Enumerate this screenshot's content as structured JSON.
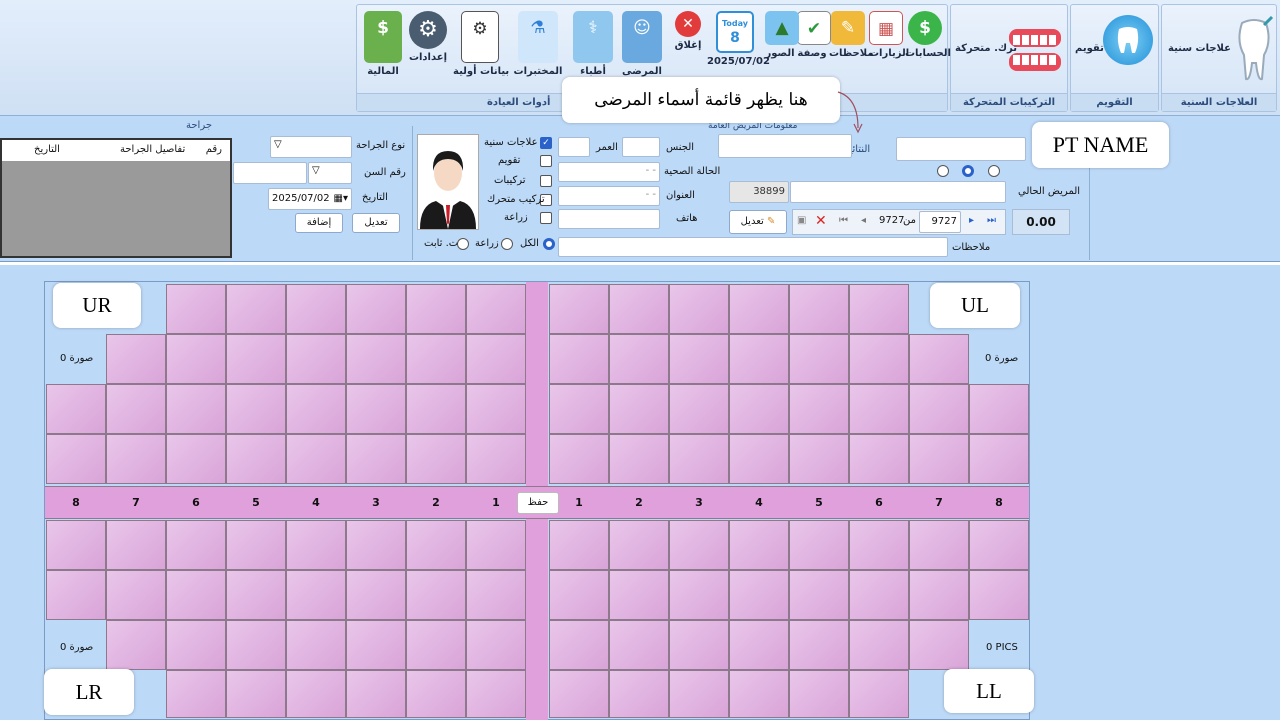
{
  "ribbon": {
    "groups": {
      "dental": "العلاجات السنية",
      "ortho": "التقويم",
      "movable": "التركيبات المتحركة",
      "clinic_tools": "أدوات العيادة"
    },
    "dental_label": "علاجات سنية",
    "ortho_label": "تقويم",
    "movable_label": "ترك. متحركة",
    "buttons": {
      "accounts": "الحسابات",
      "visits": "الزيارات",
      "notes": "ملاحظات",
      "prescription": "وصفة",
      "photos": "الصور",
      "date": "2025/07/02",
      "close": "إغلاق",
      "patients": "المرضى",
      "doctors": "أطباء",
      "labs": "المختبرات",
      "basic_data": "بيانات أولية",
      "settings": "إعدادات",
      "finance": "المالية"
    },
    "calendar_today": "Today",
    "calendar_day": "8"
  },
  "surgery": {
    "title": "جراحة",
    "columns": [
      "رقم",
      "تفاصيل الجراحة",
      "التاريخ"
    ],
    "type_label": "نوع الجراحة",
    "tooth_label": "رقم السن",
    "date_label": "التاريخ",
    "date_value": "2025/07/02",
    "add_btn": "إضافة",
    "edit_btn": "تعديل"
  },
  "patient": {
    "section_title": "معلومات المريض العامة",
    "results_label": "النتائج",
    "current_patient_label": "المريض الحالي",
    "balance": "0.00",
    "id_value": "38899",
    "nav_current": "9727",
    "nav_of": "من",
    "nav_total": "9727",
    "edit_btn": "تعديل",
    "notes_label": "ملاحظات",
    "gender_label": "الجنس",
    "age_label": "العمر",
    "health_label": "الحالة الصحية",
    "address_label": "العنوان",
    "phone_label": "هاتف",
    "dash_1": "- -",
    "dash_2": "- -",
    "checks": [
      "علاجات سنية",
      "تقويم",
      "تركيبات",
      "تركيب متحرك",
      "زراعة"
    ],
    "filter_all": "الكل",
    "filter_implant": "زراعة",
    "filter_fixed": "ت. ثابت"
  },
  "annotations": {
    "list_note": "هنا يظهر قائمة أسماء المرضى",
    "pt_name": "PT NAME",
    "ur": "UR",
    "ul": "UL",
    "lr": "LR",
    "ll": "LL"
  },
  "chart": {
    "pics_ur": "صورة 0",
    "pics_ul": "صورة 0",
    "pics_lr": "صورة 0",
    "pics_ll": "0 PICS",
    "save_btn": "حفظ",
    "left_numbers": [
      "8",
      "7",
      "6",
      "5",
      "4",
      "3",
      "2",
      "1"
    ],
    "right_numbers": [
      "1",
      "2",
      "3",
      "4",
      "5",
      "6",
      "7",
      "8"
    ]
  },
  "colors": {
    "background": "#bcd9f7",
    "tooth_fill": "#dcaadb",
    "number_band": "#dfa0dc",
    "accent": "#2a62c9"
  }
}
